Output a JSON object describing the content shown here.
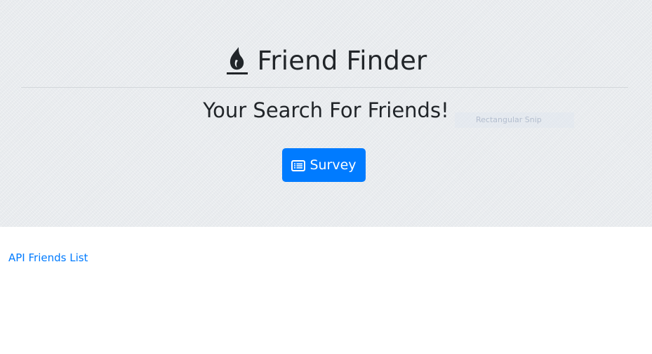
{
  "header": {
    "title": "Friend Finder",
    "title_icon": "fire-icon",
    "subtitle": "Your Search For Friends!",
    "survey_button": {
      "label": "Survey",
      "icon": "list-card-icon"
    },
    "overlay_text": "Rectangular Snip"
  },
  "main": {
    "api_link_label": "API Friends List"
  },
  "colors": {
    "jumbotron_bg": "#e9ecef",
    "primary": "#007bff",
    "text": "#212529"
  }
}
